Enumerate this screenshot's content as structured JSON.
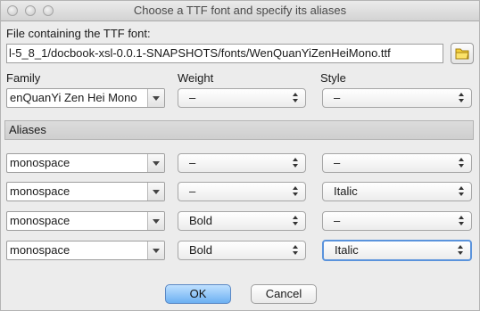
{
  "window": {
    "title": "Choose a TTF font and specify its aliases"
  },
  "file": {
    "label": "File containing the TTF font:",
    "path": "l-5_8_1/docbook-xsl-0.0.1-SNAPSHOTS/fonts/WenQuanYiZenHeiMono.ttf"
  },
  "columns": {
    "family": "Family",
    "weight": "Weight",
    "style": "Style"
  },
  "font": {
    "family": "enQuanYi Zen Hei Mono",
    "weight": "–",
    "style": "–"
  },
  "aliases": {
    "header": "Aliases",
    "rows": [
      {
        "family": "monospace",
        "weight": "–",
        "style": "–"
      },
      {
        "family": "monospace",
        "weight": "–",
        "style": "Italic"
      },
      {
        "family": "monospace",
        "weight": "Bold",
        "style": "–"
      },
      {
        "family": "monospace",
        "weight": "Bold",
        "style": "Italic"
      }
    ]
  },
  "buttons": {
    "ok": "OK",
    "cancel": "Cancel"
  }
}
